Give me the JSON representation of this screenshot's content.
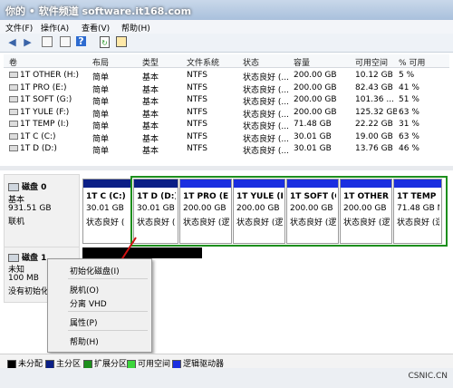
{
  "window": {
    "title": "你的 • 软件频道 software.it168.com"
  },
  "menu": [
    "文件(F)",
    "操作(A)",
    "查看(V)",
    "帮助(H)"
  ],
  "toolbar_icons": [
    "back-icon",
    "forward-icon",
    "up-icon",
    "properties-icon",
    "help-icon",
    "refresh-icon",
    "settings-icon"
  ],
  "table": {
    "headers": [
      "卷",
      "布局",
      "类型",
      "文件系统",
      "状态",
      "容量",
      "可用空间",
      "% 可用"
    ],
    "rows": [
      [
        "1T OTHER (H:)",
        "简单",
        "基本",
        "NTFS",
        "状态良好 (...",
        "200.00 GB",
        "10.12 GB",
        "5 %"
      ],
      [
        "1T PRO (E:)",
        "简单",
        "基本",
        "NTFS",
        "状态良好 (...",
        "200.00 GB",
        "82.43 GB",
        "41 %"
      ],
      [
        "1T SOFT (G:)",
        "简单",
        "基本",
        "NTFS",
        "状态良好 (...",
        "200.00 GB",
        "101.36 ...",
        "51 %"
      ],
      [
        "1T YULE (F:)",
        "简单",
        "基本",
        "NTFS",
        "状态良好 (...",
        "200.00 GB",
        "125.32 GB",
        "63 %"
      ],
      [
        "1T TEMP (I:)",
        "简单",
        "基本",
        "NTFS",
        "状态良好 (...",
        "71.48 GB",
        "22.22 GB",
        "31 %"
      ],
      [
        "1T C (C:)",
        "简单",
        "基本",
        "NTFS",
        "状态良好 (...",
        "30.01 GB",
        "19.00 GB",
        "63 %"
      ],
      [
        "1T D (D:)",
        "简单",
        "基本",
        "NTFS",
        "状态良好 (...",
        "30.01 GB",
        "13.76 GB",
        "46 %"
      ]
    ]
  },
  "disk0": {
    "name": "磁盘 0",
    "type": "基本",
    "size": "931.51 GB",
    "status": "联机",
    "partitions": [
      {
        "name": "1T C (C:)",
        "size": "30.01 GB",
        "status": "状态良好 ("
      },
      {
        "name": "1T D (D:)",
        "size": "30.01 GB",
        "status": "状态良好 ("
      },
      {
        "name": "1T PRO (E:)",
        "size": "200.00 GB N",
        "status": "状态良好 (逻"
      },
      {
        "name": "1T YULE (F",
        "size": "200.00 GB N",
        "status": "状态良好 (逻"
      },
      {
        "name": "1T SOFT (G",
        "size": "200.00 GB N",
        "status": "状态良好 (逻"
      },
      {
        "name": "1T OTHER",
        "size": "200.00 GB N",
        "status": "状态良好 (逻"
      },
      {
        "name": "1T TEMP",
        "size": "71.48 GB N",
        "status": "状态良好 (逻"
      }
    ]
  },
  "disk1": {
    "name": "磁盘 1",
    "type": "未知",
    "size": "100 MB",
    "status": "没有初始化"
  },
  "context_menu": {
    "items": [
      "初始化磁盘(I)",
      "脱机(O)",
      "分离 VHD",
      "属性(P)",
      "帮助(H)"
    ]
  },
  "legend": [
    {
      "label": "未分配",
      "color": "#000000"
    },
    {
      "label": "主分区",
      "color": "#0b1f86"
    },
    {
      "label": "扩展分区",
      "color": "#1d8f1d"
    },
    {
      "label": "可用空间",
      "color": "#3cd63c"
    },
    {
      "label": "逻辑驱动器",
      "color": "#1a2ee0"
    }
  ],
  "watermark": "CSNIC.CN",
  "colors": {
    "primary": "#0b1f86",
    "extended": "#1d8f1d",
    "unallocated": "#000000"
  }
}
